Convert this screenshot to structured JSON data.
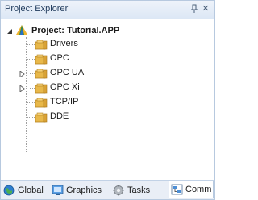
{
  "panel": {
    "title": "Project Explorer",
    "pin_icon": "pin-icon",
    "close_icon": "close-icon",
    "close_glyph": "✕"
  },
  "tree": {
    "root": {
      "label": "Project: Tutorial.APP",
      "icon": "project-icon",
      "expanded": true
    },
    "items": [
      {
        "label": "Drivers",
        "icon": "folder-icon",
        "expandable": false
      },
      {
        "label": "OPC",
        "icon": "folder-icon",
        "expandable": false
      },
      {
        "label": "OPC UA",
        "icon": "folder-icon",
        "expandable": true
      },
      {
        "label": "OPC Xi",
        "icon": "folder-icon",
        "expandable": true
      },
      {
        "label": "TCP/IP",
        "icon": "folder-icon",
        "expandable": false
      },
      {
        "label": "DDE",
        "icon": "folder-icon",
        "expandable": false
      }
    ]
  },
  "tabs": [
    {
      "label": "Global",
      "icon": "globe-icon",
      "active": false
    },
    {
      "label": "Graphics",
      "icon": "graphics-icon",
      "active": false
    },
    {
      "label": "Tasks",
      "icon": "tasks-icon",
      "active": false
    },
    {
      "label": "Comm",
      "icon": "comm-icon",
      "active": true
    }
  ],
  "colors": {
    "title_bg": "#dce7f5",
    "folder": "#e8b84a",
    "tab_bar": "#e9eef6"
  }
}
